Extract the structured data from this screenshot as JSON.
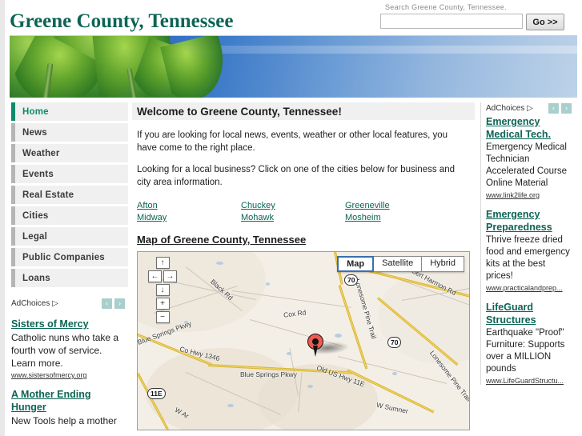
{
  "header": {
    "site_title": "Greene County, Tennessee",
    "search_label": "Search Greene County, Tennessee.",
    "search_value": "",
    "search_placeholder": "",
    "go_label": "Go >>"
  },
  "sidebar": {
    "items": [
      {
        "label": "Home",
        "active": true
      },
      {
        "label": "News",
        "active": false
      },
      {
        "label": "Weather",
        "active": false
      },
      {
        "label": "Events",
        "active": false
      },
      {
        "label": "Real Estate",
        "active": false
      },
      {
        "label": "Cities",
        "active": false
      },
      {
        "label": "Legal",
        "active": false
      },
      {
        "label": "Public Companies",
        "active": false
      },
      {
        "label": "Loans",
        "active": false
      }
    ],
    "ads": {
      "adchoices_label": "AdChoices",
      "prev_arrow": "‹",
      "next_arrow": "›",
      "items": [
        {
          "title": "Sisters of Mercy",
          "desc": "Catholic nuns who take a fourth vow of service. Learn more.",
          "url": "www.sistersofmercy.org"
        },
        {
          "title": "A Mother Ending Hunger",
          "desc": "New Tools help a mother",
          "url": ""
        }
      ]
    }
  },
  "main": {
    "welcome_heading": "Welcome to Greene County, Tennessee!",
    "paragraph_1": "If you are looking for local news, events, weather or other local features, you have come to the right place.",
    "paragraph_2": "Looking for a local business? Click on one of the cities below for business and city area information.",
    "cities": [
      "Afton",
      "Chuckey",
      "Greeneville",
      "Midway",
      "Mohawk",
      "Mosheim"
    ],
    "map_heading": "Map of Greene County, Tennessee",
    "map": {
      "types": [
        {
          "label": "Map",
          "selected": true
        },
        {
          "label": "Satellite",
          "selected": false
        },
        {
          "label": "Hybrid",
          "selected": false
        }
      ],
      "controls": {
        "up": "↑",
        "left": "←",
        "right": "→",
        "down": "↓",
        "zoom_in": "+",
        "zoom_out": "−"
      },
      "road_labels": [
        "Black Rd",
        "Cox Rd",
        "Robert Harmon Rd",
        "Lonesome Pine Trail",
        "Lonesome Pine Trail",
        "Blue Springs Pkwy",
        "Co Hwy 1346",
        "Old US Hwy 11E",
        "Blue Springs Pkwy",
        "W Sumner",
        "W Ar"
      ],
      "shields": [
        "70",
        "70",
        "11E"
      ]
    }
  },
  "right": {
    "adchoices_label": "AdChoices",
    "prev_arrow": "‹",
    "next_arrow": "›",
    "ads": [
      {
        "title": "Emergency Medical Tech.",
        "desc": "Emergency Medical Technician Accelerated Course Online Material",
        "url": "www.link2life.org"
      },
      {
        "title": "Emergency Preparedness",
        "desc": "Thrive freeze dried food and emergency kits at the best prices!",
        "url": "www.practicalandprep..."
      },
      {
        "title": "LifeGuard Structures",
        "desc": "Earthquake \"Proof\" Furniture: Supports over a MILLION pounds",
        "url": "www.LifeGuardStructu..."
      }
    ]
  },
  "colors": {
    "brand_teal": "#0d6455",
    "accent_teal": "#0d8a6a",
    "nav_bg": "#f0f0f0",
    "nav_accent_gray": "#b5b5b5",
    "banner_blue": "#2a63bf",
    "map_land": "#f3efe7",
    "map_road_yellow": "#f6d860",
    "marker_red": "#f05a4f"
  }
}
